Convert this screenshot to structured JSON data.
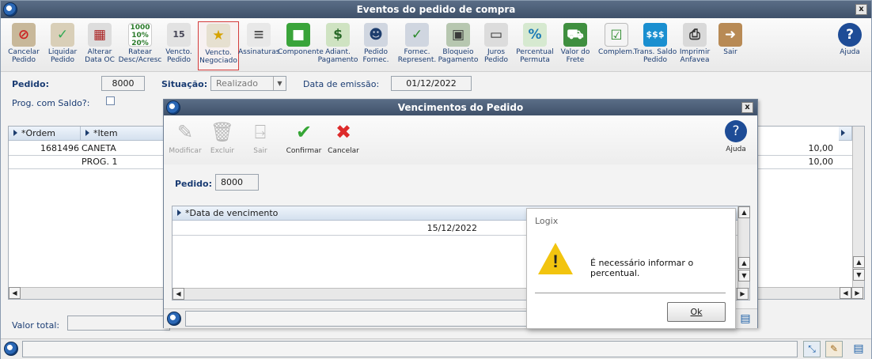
{
  "window": {
    "title": "Eventos do pedido de compra"
  },
  "toolbar": {
    "items": [
      {
        "label": "Cancelar\nPedido"
      },
      {
        "label": "Liquidar\nPedido"
      },
      {
        "label": "Alterar\nData OC"
      },
      {
        "label": "Ratear\nDesc/Acresc"
      },
      {
        "label": "Vencto.\nPedido"
      },
      {
        "label": "Vencto.\nNegociado"
      },
      {
        "label": "Assinaturas"
      },
      {
        "label": "Componente"
      },
      {
        "label": "Adiant.\nPagamento"
      },
      {
        "label": "Pedido\nFornec."
      },
      {
        "label": "Fornec.\nRepresent."
      },
      {
        "label": "Bloqueio\nPagamento"
      },
      {
        "label": "Juros\nPedido"
      },
      {
        "label": "Percentual\nPermuta"
      },
      {
        "label": "Valor do\nFrete"
      },
      {
        "label": "Complem."
      },
      {
        "label": "Trans. Saldo\nPedido"
      },
      {
        "label": "Imprimir\nAnfavea"
      },
      {
        "label": "Sair"
      },
      {
        "label": "Ajuda"
      }
    ],
    "ratear_numbers": [
      "1000",
      "10%",
      "20%"
    ],
    "calendar_day": "15"
  },
  "form": {
    "pedido_label": "Pedido:",
    "pedido_value": "8000",
    "situacao_label": "Situação:",
    "situacao_value": "Realizado",
    "data_emissao_label": "Data de emissão:",
    "data_emissao_value": "01/12/2022",
    "prog_saldo_label": "Prog. com Saldo?:",
    "valor_total_label": "Valor total:"
  },
  "grid": {
    "columns": [
      "*Ordem",
      "*Item"
    ],
    "rows": [
      {
        "ordem": "1681496",
        "item": "CANETA",
        "valor": "10,00"
      },
      {
        "ordem": "",
        "item": "PROG.   1",
        "valor": "10,00"
      }
    ]
  },
  "dialog": {
    "title": "Vencimentos do Pedido",
    "buttons": [
      {
        "label": "Modificar"
      },
      {
        "label": "Excluir"
      },
      {
        "label": "Sair"
      },
      {
        "label": "Confirmar"
      },
      {
        "label": "Cancelar"
      },
      {
        "label": "Ajuda"
      }
    ],
    "pedido_label": "Pedido:",
    "pedido_value": "8000",
    "column": "*Data de vencimento",
    "rows": [
      "15/12/2022"
    ]
  },
  "message": {
    "title": "Logix",
    "text": "É necessário informar o percentual.",
    "ok_label": "Ok"
  }
}
